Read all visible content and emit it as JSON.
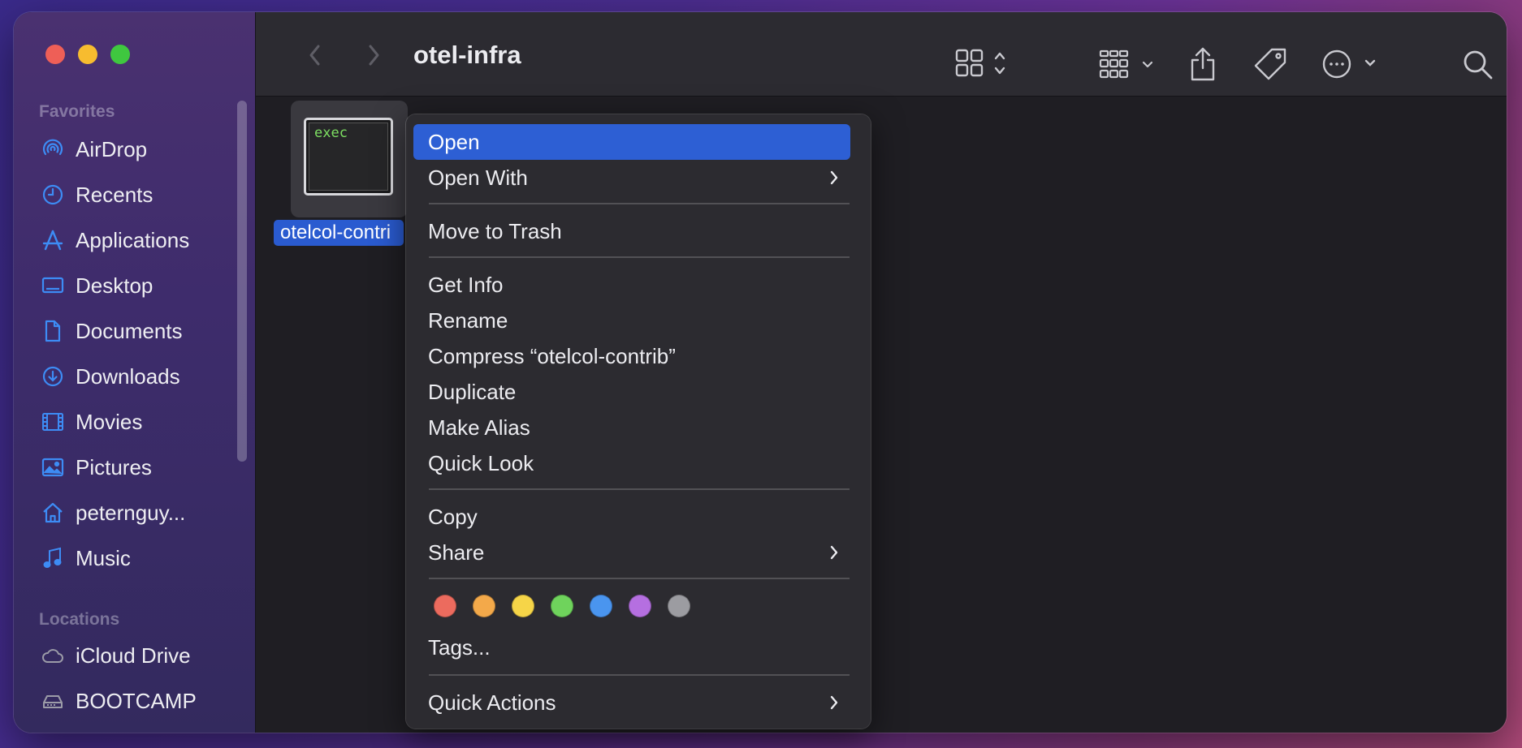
{
  "window": {
    "title": "otel-infra"
  },
  "sidebar": {
    "favorites_label": "Favorites",
    "favorites": [
      {
        "label": "AirDrop",
        "icon": "airdrop-icon"
      },
      {
        "label": "Recents",
        "icon": "clock-icon"
      },
      {
        "label": "Applications",
        "icon": "applications-icon"
      },
      {
        "label": "Desktop",
        "icon": "desktop-icon"
      },
      {
        "label": "Documents",
        "icon": "document-icon"
      },
      {
        "label": "Downloads",
        "icon": "download-icon"
      },
      {
        "label": "Movies",
        "icon": "film-icon"
      },
      {
        "label": "Pictures",
        "icon": "photo-icon"
      },
      {
        "label": "peternguy...",
        "icon": "home-icon"
      },
      {
        "label": "Music",
        "icon": "music-icon"
      }
    ],
    "locations_label": "Locations",
    "locations": [
      {
        "label": "iCloud Drive",
        "icon": "cloud-icon"
      },
      {
        "label": "BOOTCAMP",
        "icon": "drive-icon"
      }
    ]
  },
  "file": {
    "name": "otelcol-contri",
    "icon_text": "exec"
  },
  "context_menu": {
    "open": "Open",
    "open_with": "Open With",
    "move_to_trash": "Move to Trash",
    "get_info": "Get Info",
    "rename": "Rename",
    "compress": "Compress “otelcol-contrib”",
    "duplicate": "Duplicate",
    "make_alias": "Make Alias",
    "quick_look": "Quick Look",
    "copy": "Copy",
    "share": "Share",
    "tags": "Tags...",
    "quick_actions": "Quick Actions",
    "tag_colors": [
      "#ec6b5e",
      "#f3a94a",
      "#f6d548",
      "#6fd35c",
      "#4a95ef",
      "#b56fe0",
      "#9c9ca1"
    ]
  },
  "colors": {
    "accent": "#2d5fd4",
    "selection": "#2a5bd0",
    "sidebar_icon": "#3d8cf5"
  }
}
